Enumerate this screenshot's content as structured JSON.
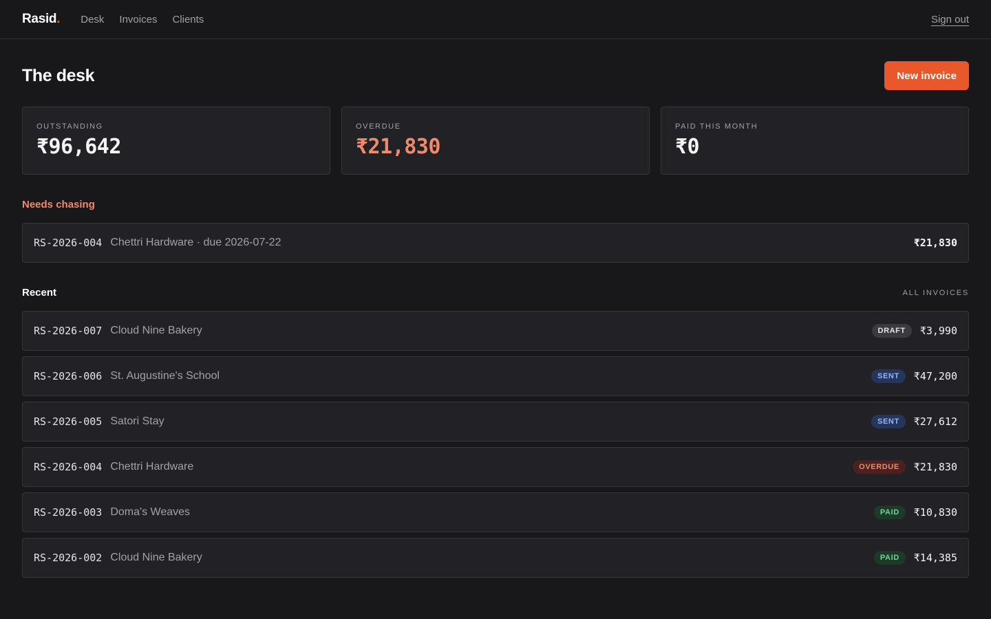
{
  "brand": {
    "name": "Rasid",
    "dot": "."
  },
  "nav": {
    "items": [
      "Desk",
      "Invoices",
      "Clients"
    ]
  },
  "signout_label": "Sign out",
  "page": {
    "title": "The desk",
    "new_invoice_label": "New invoice"
  },
  "stats": [
    {
      "label": "OUTSTANDING",
      "value": "₹96,642"
    },
    {
      "label": "OVERDUE",
      "value": "₹21,830"
    },
    {
      "label": "PAID THIS MONTH",
      "value": "₹0"
    }
  ],
  "chasing": {
    "title": "Needs chasing",
    "items": [
      {
        "id": "RS-2026-004",
        "client": "Chettri Hardware · due 2026-07-22",
        "amount": "₹21,830"
      }
    ]
  },
  "recent": {
    "title": "Recent",
    "all_link": "ALL INVOICES",
    "items": [
      {
        "id": "RS-2026-007",
        "client": "Cloud Nine Bakery",
        "status": "DRAFT",
        "amount": "₹3,990"
      },
      {
        "id": "RS-2026-006",
        "client": "St. Augustine's School",
        "status": "SENT",
        "amount": "₹47,200"
      },
      {
        "id": "RS-2026-005",
        "client": "Satori Stay",
        "status": "SENT",
        "amount": "₹27,612"
      },
      {
        "id": "RS-2026-004",
        "client": "Chettri Hardware",
        "status": "OVERDUE",
        "amount": "₹21,830"
      },
      {
        "id": "RS-2026-003",
        "client": "Doma's Weaves",
        "status": "PAID",
        "amount": "₹10,830"
      },
      {
        "id": "RS-2026-002",
        "client": "Cloud Nine Bakery",
        "status": "PAID",
        "amount": "₹14,385"
      }
    ]
  },
  "colors": {
    "background": "#18181b",
    "accent": "#e8582a",
    "overdue": "#f08a6a",
    "sent": "#93b4ff",
    "paid": "#6fd49a"
  }
}
